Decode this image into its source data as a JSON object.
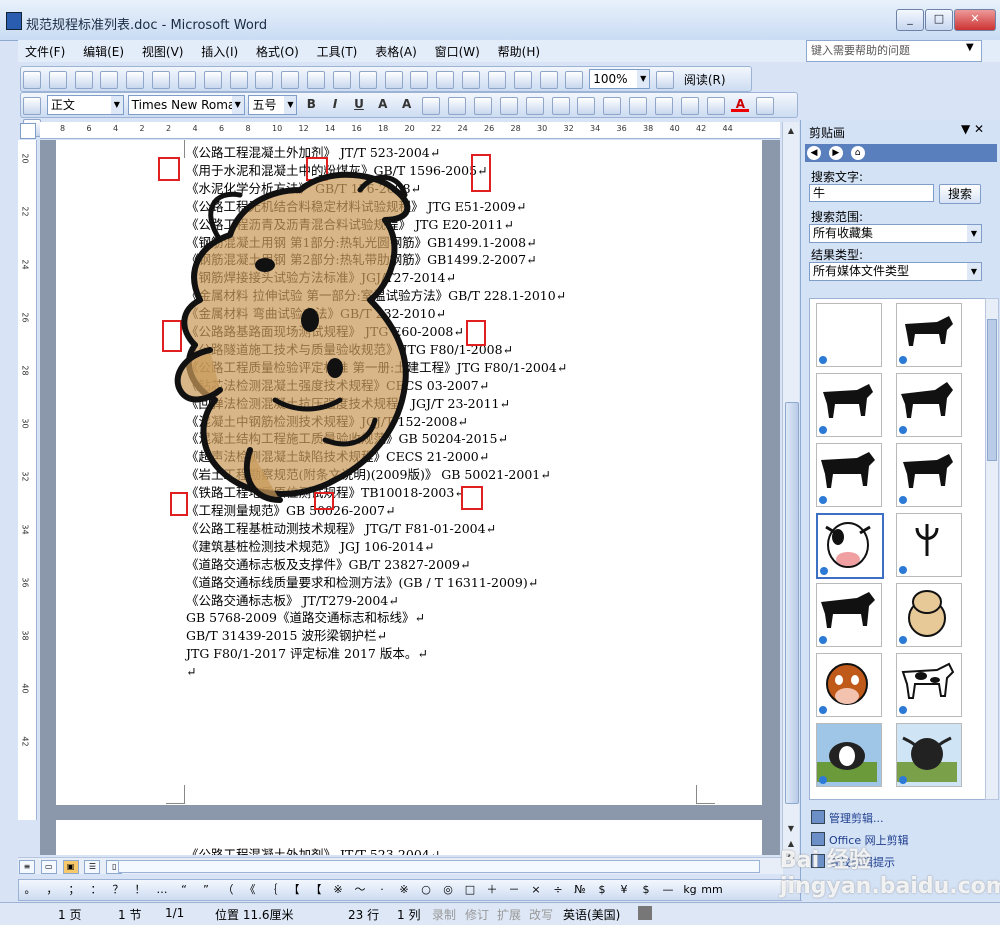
{
  "window": {
    "title": "规范规程标准列表.doc - Microsoft Word",
    "buttons": {
      "minimize": "_",
      "maximize": "□",
      "close": "✕"
    }
  },
  "menu": {
    "items": [
      "文件(F)",
      "编辑(E)",
      "视图(V)",
      "插入(I)",
      "格式(O)",
      "工具(T)",
      "表格(A)",
      "窗口(W)",
      "帮助(H)"
    ],
    "help_placeholder": "键入需要帮助的问题"
  },
  "toolbar_standard": {
    "zoom": "100%",
    "reading": "阅读(R)"
  },
  "toolbar_format": {
    "style": "正文",
    "font": "Times New Roman",
    "size": "五号"
  },
  "ruler": {
    "h_ticks": [
      "8",
      "6",
      "4",
      "2",
      "2",
      "4",
      "6",
      "8",
      "10",
      "12",
      "14",
      "16",
      "18",
      "20",
      "22",
      "24",
      "26",
      "28",
      "30",
      "32",
      "34",
      "36",
      "38",
      "40",
      "42",
      "44"
    ],
    "v_ticks": [
      "20",
      "22",
      "24",
      "26",
      "28",
      "30",
      "32",
      "34",
      "36",
      "38",
      "40",
      "42"
    ]
  },
  "document": {
    "lines": [
      "《公路工程混凝土外加剂》 JT/T 523-2004↵",
      "《用于水泥和混凝土中的粉煤灰》GB/T 1596-2005↵",
      "《水泥化学分析方法》 GB/T 176-2008↵",
      "《公路工程无机结合料稳定材料试验规程》 JTG E51-2009↵",
      "《公路工程沥青及沥青混合料试验规程》 JTG E20-2011↵",
      "《钢筋混凝土用钢 第1部分:热轧光圆钢筋》GB1499.1-2008↵",
      "《钢筋混凝土用钢 第2部分:热轧带肋钢筋》GB1499.2-2007↵",
      "《钢筋焊接接头试验方法标准》JGJ/T27-2014↵",
      "《金属材料 拉伸试验 第一部分:室温试验方法》GB/T 228.1-2010↵",
      "《金属材料 弯曲试验方法》GB/T 232-2010↵",
      "《公路路基路面现场测试规程》 JTG E60-2008↵",
      "《公路隧道施工技术与质量验收规范》 JTG F80/1-2008↵",
      "《公路工程质量检验评定标准 第一册:土建工程》JTG F80/1-2004↵",
      "《钻芯法检测混凝土强度技术规程》CECS 03-2007↵",
      "《回弹法检测混凝土抗压强度技术规程》JGJ/T 23-2011↵",
      "《混凝土中钢筋检测技术规程》JGJ/T 152-2008↵",
      "《混凝土结构工程施工质量验收规范》GB 50204-2015↵",
      "《超声法检测混凝土缺陷技术规程》CECS 21-2000↵",
      "《岩土工程勘察规范(附条文说明)(2009版)》 GB 50021-2001↵",
      "《铁路工程地质原位测试规程》TB10018-2003↵",
      "《工程测量规范》GB 50026-2007↵",
      "《公路工程基桩动测技术规程》 JTG/T F81-01-2004↵",
      "《建筑基桩检测技术规范》 JGJ 106-2014↵",
      "《道路交通标志板及支撑件》GB/T 23827-2009↵",
      "《道路交通标线质量要求和检测方法》(GB / T 16311-2009)↵",
      "《公路交通标志板》 JT/T279-2004↵",
      "GB 5768-2009《道路交通标志和标线》↵",
      "GB/T 31439-2015 波形梁钢护栏↵",
      "JTG F80/1-2017 评定标准 2017 版本。↵",
      "↵"
    ],
    "page2_line": "《公路工程混凝土外加剂》 JT/T 523-2004↵"
  },
  "symbols": [
    "。",
    "，",
    "；",
    "：",
    "？",
    "！",
    "…",
    "“",
    "”",
    "（",
    "《",
    "｛",
    "【",
    "【",
    "※",
    "～",
    "·",
    "※",
    "○",
    "◎",
    "□",
    "＋",
    "－",
    "×",
    "÷",
    "№",
    "$",
    "¥",
    "$",
    "—",
    "kg",
    "mm"
  ],
  "statusbar": {
    "page": "1 页",
    "section": "1 节",
    "pages": "1/1",
    "position": "位置 11.6厘米",
    "line": "23 行",
    "column": "1 列",
    "rec": "录制",
    "trk": "修订",
    "ext": "扩展",
    "ovr": "改写",
    "language": "英语(美国)"
  },
  "taskpane": {
    "title": "剪贴画",
    "search_label": "搜索文字:",
    "search_value": "牛",
    "search_button": "搜索",
    "scope_label": "搜索范围:",
    "scope_value": "所有收藏集",
    "type_label": "结果类型:",
    "type_value": "所有媒体文件类型",
    "links": [
      "管理剪辑...",
      "Office 网上剪辑",
      "查找剪辑提示"
    ]
  },
  "watermark": "Bai 经验 jingyan.baidu.com",
  "colors": {
    "accent": "#5a7fbd",
    "highlight_box": "#e02020",
    "cartoon_fill": "#c99a5a"
  }
}
